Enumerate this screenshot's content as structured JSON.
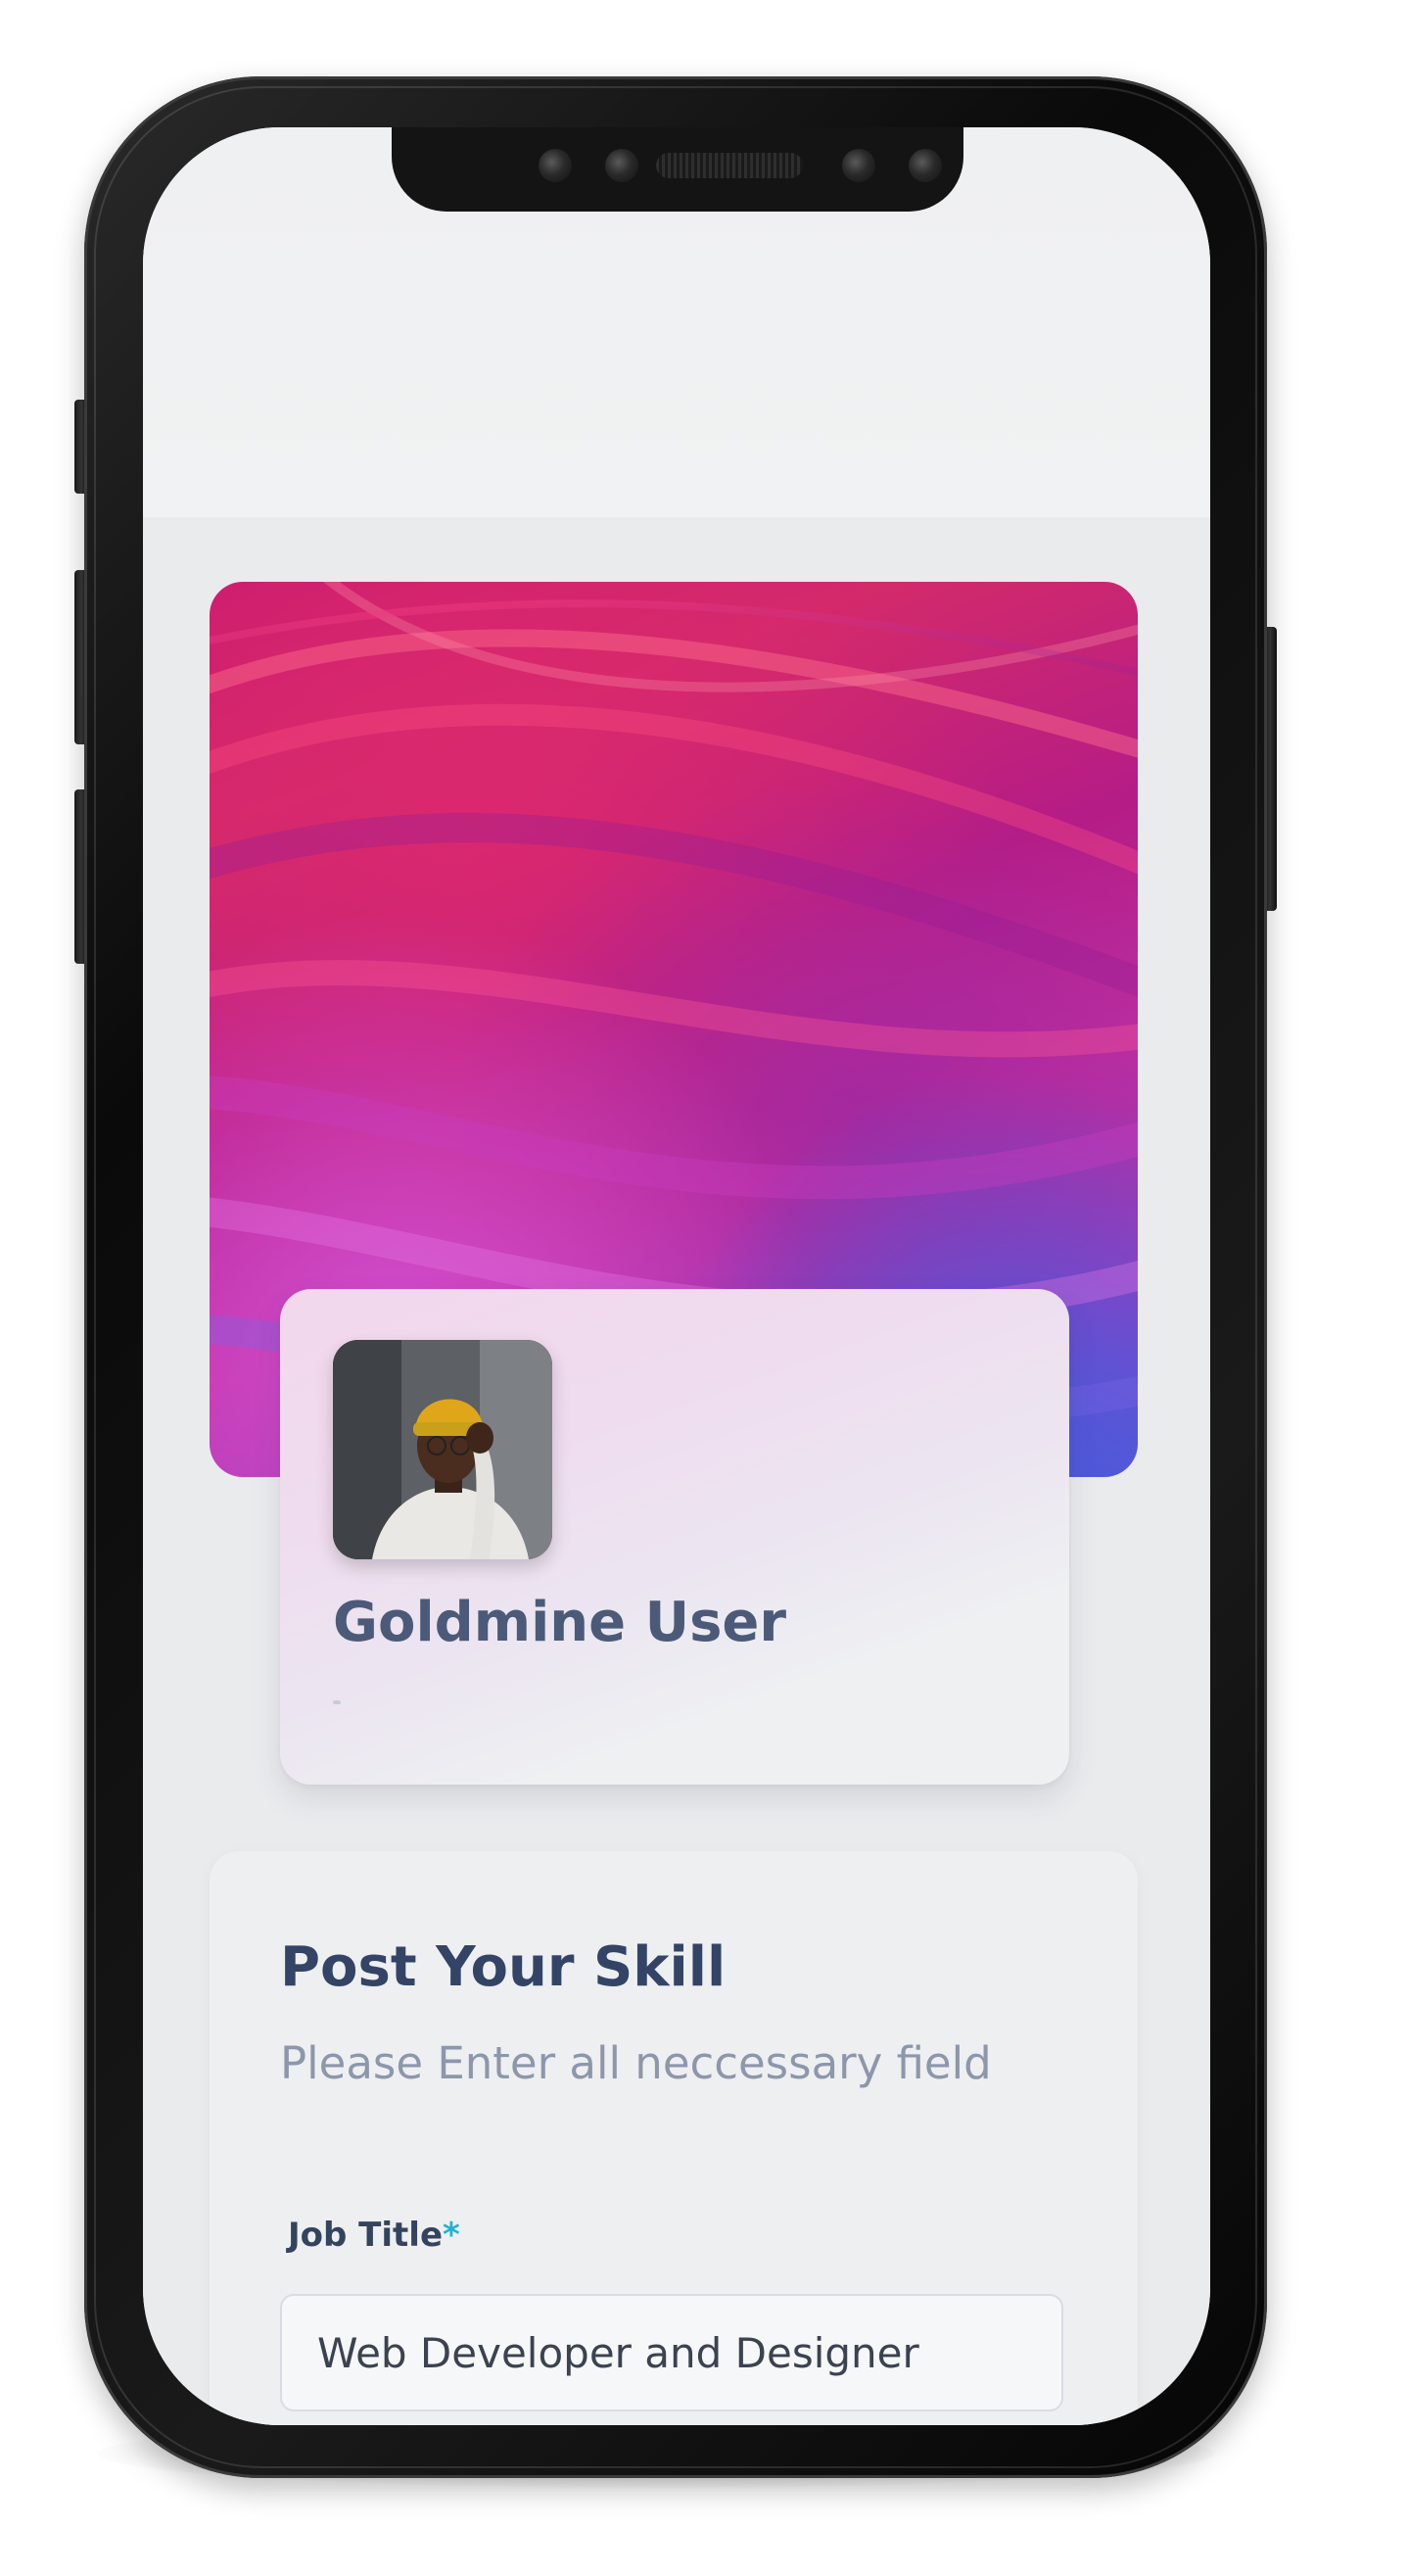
{
  "profile": {
    "user_name": "Goldmine User"
  },
  "post_skill": {
    "title": "Post Your Skill",
    "subtitle": "Please Enter all neccessary field",
    "job_title": {
      "label": "Job Title",
      "required_mark": "*",
      "value": "Web Developer and Designer"
    }
  },
  "colors": {
    "heading": "#334466",
    "name": "#4b5a78",
    "subtitle": "#8d97ab",
    "required_accent": "#1fb3d6",
    "background": "#eaebed"
  },
  "icons": {
    "avatar": "user-photo-avatar",
    "banner": "abstract-wave-banner"
  }
}
